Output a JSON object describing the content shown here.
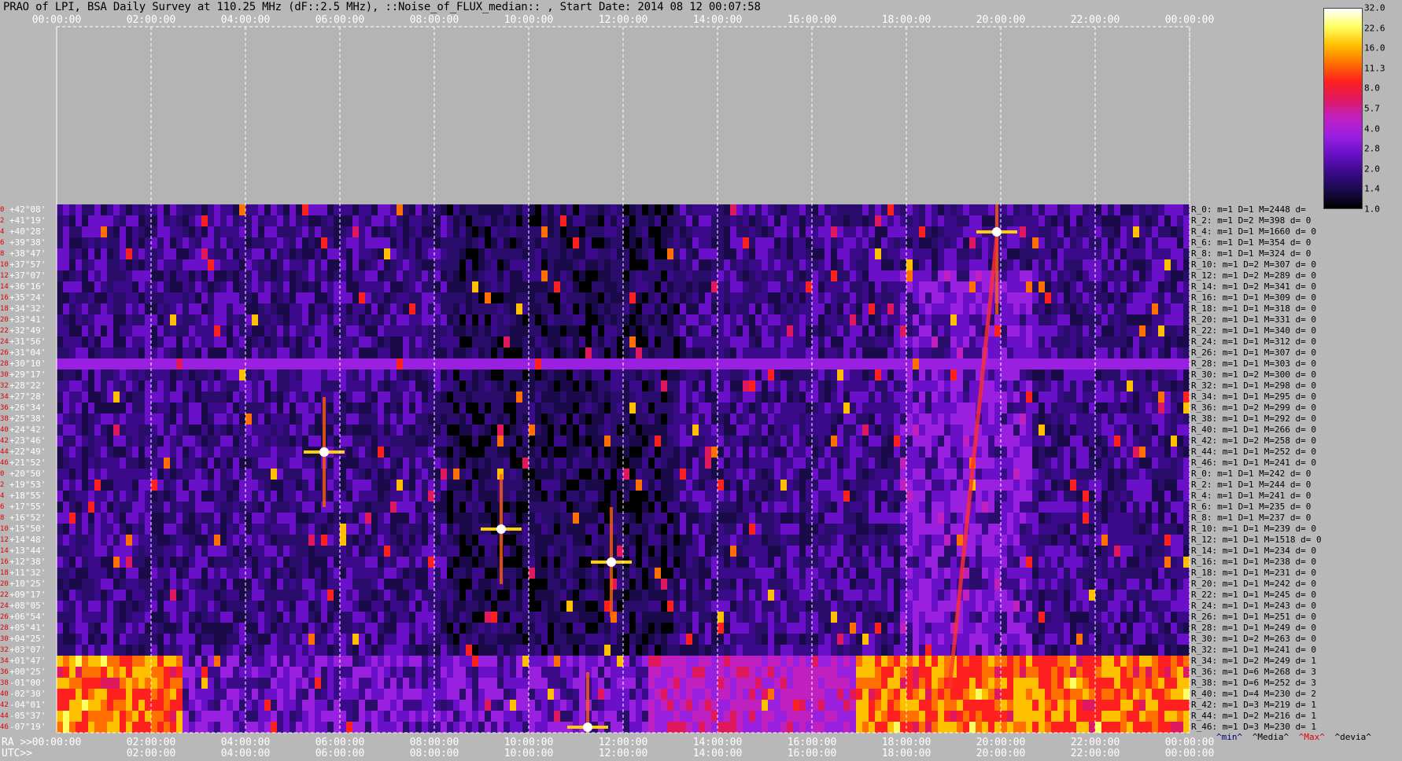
{
  "title": "PRAO of LPI, BSA Daily Survey at 110.25 MHz (dF::2.5 MHz), ::Noise_of_FLUX_median:: , Start Date: 2014 08 12 00:07:58",
  "top_axis": [
    "00:00:00",
    "02:00:00",
    "04:00:00",
    "06:00:00",
    "08:00:00",
    "10:00:00",
    "12:00:00",
    "14:00:00",
    "16:00:00",
    "18:00:00",
    "20:00:00",
    "22:00:00",
    "00:00:00"
  ],
  "ra_axis_label": "RA >>",
  "ra_axis": [
    "00:00:00",
    "02:00:00",
    "04:00:00",
    "06:00:00",
    "08:00:00",
    "10:00:00",
    "12:00:00",
    "14:00:00",
    "16:00:00",
    "18:00:00",
    "20:00:00",
    "22:00:00",
    "00:00:00"
  ],
  "utc_axis_label": "UTC>>",
  "utc_axis": [
    "02:00:00",
    "04:00:00",
    "06:00:00",
    "08:00:00",
    "10:00:00",
    "12:00:00",
    "14:00:00",
    "16:00:00",
    "18:00:00",
    "20:00:00",
    "22:00:00",
    "00:00:00"
  ],
  "colorbar": {
    "ticks": [
      "32.0",
      "22.6",
      "16.0",
      "11.3",
      "8.0",
      "5.7",
      "4.0",
      "2.8",
      "2.0",
      "1.4",
      "1.0"
    ],
    "colors": [
      "#000000",
      "#1a0a4a",
      "#3a0a8a",
      "#6a10c8",
      "#9a20e0",
      "#c020c0",
      "#e01860",
      "#ff2020",
      "#ff7000",
      "#ffc000",
      "#ffff60",
      "#ffffff"
    ]
  },
  "stats_legend": {
    "min": "^min^",
    "median": "^Media^",
    "max": "^Max^",
    "dev": "^devia^"
  },
  "stats_colors": {
    "min": "#000070",
    "median": "#000",
    "max": "#e00000",
    "dev": "#000"
  },
  "chart_data": {
    "type": "heatmap",
    "title": "PRAO of LPI, BSA Daily Survey at 110.25 MHz (dF::2.5 MHz), ::Noise_of_FLUX_median:: , Start Date: 2014 08 12 00:07:58",
    "xlabel": "RA >>",
    "x_ticks": [
      "00:00:00",
      "02:00:00",
      "04:00:00",
      "06:00:00",
      "08:00:00",
      "10:00:00",
      "12:00:00",
      "14:00:00",
      "16:00:00",
      "18:00:00",
      "20:00:00",
      "22:00:00",
      "00:00:00"
    ],
    "colorbar_range": [
      1.0,
      32.0
    ],
    "colorbar_scale": "log",
    "rows": [
      {
        "idx": "0",
        "dec": "+42°08'",
        "stat": "R_0: m=1 D=1 M=2448 d="
      },
      {
        "idx": "2",
        "dec": "+41°19'",
        "stat": "R_2: m=1 D=2 M=398 d= 0"
      },
      {
        "idx": "4",
        "dec": "+40°28'",
        "stat": "R_4: m=1 D=1 M=1660 d= 0"
      },
      {
        "idx": "6",
        "dec": "+39°38'",
        "stat": "R_6: m=1 D=1 M=354 d= 0"
      },
      {
        "idx": "8",
        "dec": "+38°47'",
        "stat": "R_8: m=1 D=1 M=324 d= 0"
      },
      {
        "idx": "10",
        "dec": "+37°57'",
        "stat": "R_10: m=1 D=2 M=307 d= 0"
      },
      {
        "idx": "12",
        "dec": "+37°07'",
        "stat": "R_12: m=1 D=2 M=289 d= 0"
      },
      {
        "idx": "14",
        "dec": "+36°16'",
        "stat": "R_14: m=1 D=2 M=341 d= 0"
      },
      {
        "idx": "16",
        "dec": "+35°24'",
        "stat": "R_16: m=1 D=1 M=309 d= 0"
      },
      {
        "idx": "18",
        "dec": "+34°32'",
        "stat": "R_18: m=1 D=1 M=318 d= 0"
      },
      {
        "idx": "20",
        "dec": "+33°41'",
        "stat": "R_20: m=1 D=1 M=331 d= 0"
      },
      {
        "idx": "22",
        "dec": "+32°49'",
        "stat": "R_22: m=1 D=1 M=340 d= 0"
      },
      {
        "idx": "24",
        "dec": "+31°56'",
        "stat": "R_24: m=1 D=1 M=312 d= 0"
      },
      {
        "idx": "26",
        "dec": "+31°04'",
        "stat": "R_26: m=1 D=1 M=307 d= 0"
      },
      {
        "idx": "28",
        "dec": "+30°10'",
        "stat": "R_28: m=1 D=1 M=303 d= 0"
      },
      {
        "idx": "30",
        "dec": "+29°17'",
        "stat": "R_30: m=1 D=2 M=300 d= 0"
      },
      {
        "idx": "32",
        "dec": "+28°22'",
        "stat": "R_32: m=1 D=1 M=298 d= 0"
      },
      {
        "idx": "34",
        "dec": "+27°28'",
        "stat": "R_34: m=1 D=1 M=295 d= 0"
      },
      {
        "idx": "36",
        "dec": "+26°34'",
        "stat": "R_36: m=1 D=2 M=299 d= 0"
      },
      {
        "idx": "38",
        "dec": "+25°38'",
        "stat": "R_38: m=1 D=1 M=292 d= 0"
      },
      {
        "idx": "40",
        "dec": "+24°42'",
        "stat": "R_40: m=1 D=1 M=266 d= 0"
      },
      {
        "idx": "42",
        "dec": "+23°46'",
        "stat": "R_42: m=1 D=2 M=258 d= 0"
      },
      {
        "idx": "44",
        "dec": "+22°49'",
        "stat": "R_44: m=1 D=1 M=252 d= 0"
      },
      {
        "idx": "46",
        "dec": "+21°52'",
        "stat": "R_46: m=1 D=1 M=241 d= 0"
      },
      {
        "idx": "0",
        "dec": "+20°50'",
        "stat": "R_0: m=1 D=1 M=242 d= 0"
      },
      {
        "idx": "2",
        "dec": "+19°53'",
        "stat": "R_2: m=1 D=1 M=244 d= 0"
      },
      {
        "idx": "4",
        "dec": "+18°55'",
        "stat": "R_4: m=1 D=1 M=241 d= 0"
      },
      {
        "idx": "6",
        "dec": "+17°55'",
        "stat": "R_6: m=1 D=1 M=235 d= 0"
      },
      {
        "idx": "8",
        "dec": "+16°52'",
        "stat": "R_8: m=1 D=1 M=237 d= 0"
      },
      {
        "idx": "10",
        "dec": "+15°50'",
        "stat": "R_10: m=1 D=1 M=239 d= 0"
      },
      {
        "idx": "12",
        "dec": "+14°48'",
        "stat": "R_12: m=1 D=1 M=1518 d= 0"
      },
      {
        "idx": "14",
        "dec": "+13°44'",
        "stat": "R_14: m=1 D=1 M=234 d= 0"
      },
      {
        "idx": "16",
        "dec": "+12°38'",
        "stat": "R_16: m=1 D=1 M=238 d= 0"
      },
      {
        "idx": "18",
        "dec": "+11°32'",
        "stat": "R_18: m=1 D=1 M=231 d= 0"
      },
      {
        "idx": "20",
        "dec": "+10°25'",
        "stat": "R_20: m=1 D=1 M=242 d= 0"
      },
      {
        "idx": "22",
        "dec": "+09°17'",
        "stat": "R_22: m=1 D=1 M=245 d= 0"
      },
      {
        "idx": "24",
        "dec": "+08°05'",
        "stat": "R_24: m=1 D=1 M=243 d= 0"
      },
      {
        "idx": "26",
        "dec": "+06°54'",
        "stat": "R_26: m=1 D=1 M=251 d= 0"
      },
      {
        "idx": "28",
        "dec": "+05°41'",
        "stat": "R_28: m=1 D=1 M=249 d= 0"
      },
      {
        "idx": "30",
        "dec": "+04°25'",
        "stat": "R_30: m=1 D=2 M=263 d= 0"
      },
      {
        "idx": "32",
        "dec": "+03°07'",
        "stat": "R_32: m=1 D=1 M=241 d= 0"
      },
      {
        "idx": "34",
        "dec": "+01°47'",
        "stat": "R_34: m=1 D=2 M=249 d= 1"
      },
      {
        "idx": "36",
        "dec": "+00°25'",
        "stat": "R_36: m=1 D=6 M=268 d= 3"
      },
      {
        "idx": "38",
        "dec": "-01°00'",
        "stat": "R_38: m=1 D=6 M=252 d= 3"
      },
      {
        "idx": "40",
        "dec": "-02°30'",
        "stat": "R_40: m=1 D=4 M=230 d= 2"
      },
      {
        "idx": "42",
        "dec": "-04°01'",
        "stat": "R_42: m=1 D=3 M=219 d= 1"
      },
      {
        "idx": "44",
        "dec": "-05°37'",
        "stat": "R_44: m=1 D=2 M=216 d= 1"
      },
      {
        "idx": "46",
        "dec": "-07°19'",
        "stat": "R_46: m=1 D=3 M=230 d= 1"
      }
    ],
    "features": [
      {
        "name": "bright source",
        "ra": "19:55",
        "row": 2,
        "value": 32
      },
      {
        "name": "bright source",
        "ra": "09:25",
        "row": 29,
        "value": 32
      },
      {
        "name": "bright source",
        "ra": "11:45",
        "row": 32,
        "value": 22.6
      },
      {
        "name": "bright source",
        "ra": "05:40",
        "row": 22,
        "value": 22.6
      },
      {
        "name": "bright source",
        "ra": "11:15",
        "row": 47,
        "value": 32
      },
      {
        "name": "galactic plane band",
        "ra_start": "16:45",
        "ra_end": "24:00",
        "row_start": 41,
        "row_end": 47,
        "value": 22.6
      },
      {
        "name": "galactic plane band",
        "ra_start": "00:00",
        "ra_end": "02:40",
        "row_start": 41,
        "row_end": 47,
        "value": 22.6
      },
      {
        "name": "horizontal interference line",
        "row": 14,
        "value": 4.0
      }
    ]
  }
}
